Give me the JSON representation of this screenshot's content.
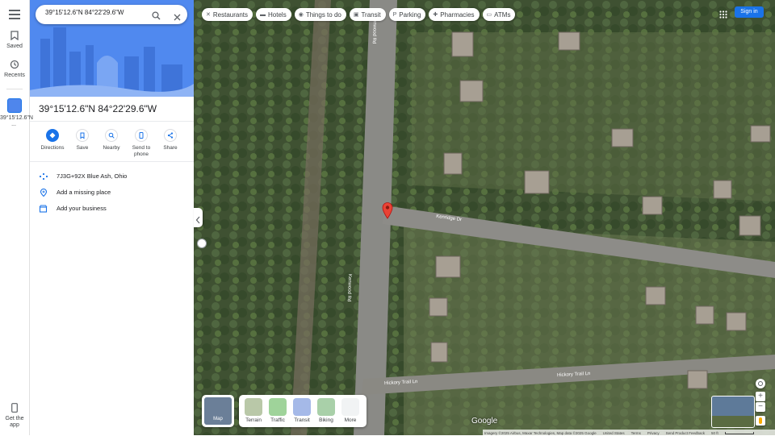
{
  "search": {
    "value": "39°15'12.6\"N 84°22'29.6\"W"
  },
  "rail": {
    "saved": "Saved",
    "recents": "Recents",
    "recent_place": "39°15'12.6\"N ...",
    "get_app": "Get the app"
  },
  "place": {
    "title": "39°15'12.6\"N 84°22'29.6\"W"
  },
  "actions": [
    {
      "label": "Directions"
    },
    {
      "label": "Save"
    },
    {
      "label": "Nearby"
    },
    {
      "label": "Send to phone"
    },
    {
      "label": "Share"
    }
  ],
  "info": {
    "plus_code": "7J3G+92X Blue Ash, Ohio",
    "add_missing": "Add a missing place",
    "add_business": "Add your business"
  },
  "chips": [
    {
      "label": "Restaurants",
      "icon": "fork-knife-icon"
    },
    {
      "label": "Hotels",
      "icon": "bed-icon"
    },
    {
      "label": "Things to do",
      "icon": "camera-icon"
    },
    {
      "label": "Transit",
      "icon": "train-icon"
    },
    {
      "label": "Parking",
      "icon": "parking-icon"
    },
    {
      "label": "Pharmacies",
      "icon": "pharmacy-icon"
    },
    {
      "label": "ATMs",
      "icon": "atm-icon"
    }
  ],
  "header": {
    "sign_in": "Sign in"
  },
  "map": {
    "streets": {
      "kenwood_a": "Kenwood Rd",
      "kenwood_b": "Kenwood Rd",
      "kenridge": "Kenridge Dr",
      "hickory": "Hickory Trail Ln",
      "hickory2": "Hickory Trail Ln"
    },
    "layer_button_label": "Map",
    "layers": [
      "Terrain",
      "Traffic",
      "Transit",
      "Biking",
      "More"
    ],
    "pin_color": "#ea4335",
    "google_logo": "Google",
    "footer": {
      "imagery": "Imagery ©2025 Airbus, Maxar Technologies, Map data ©2025 Google",
      "country": "United States",
      "terms": "Terms",
      "privacy": "Privacy",
      "feedback": "Send Product Feedback",
      "scale": "50 ft"
    }
  }
}
